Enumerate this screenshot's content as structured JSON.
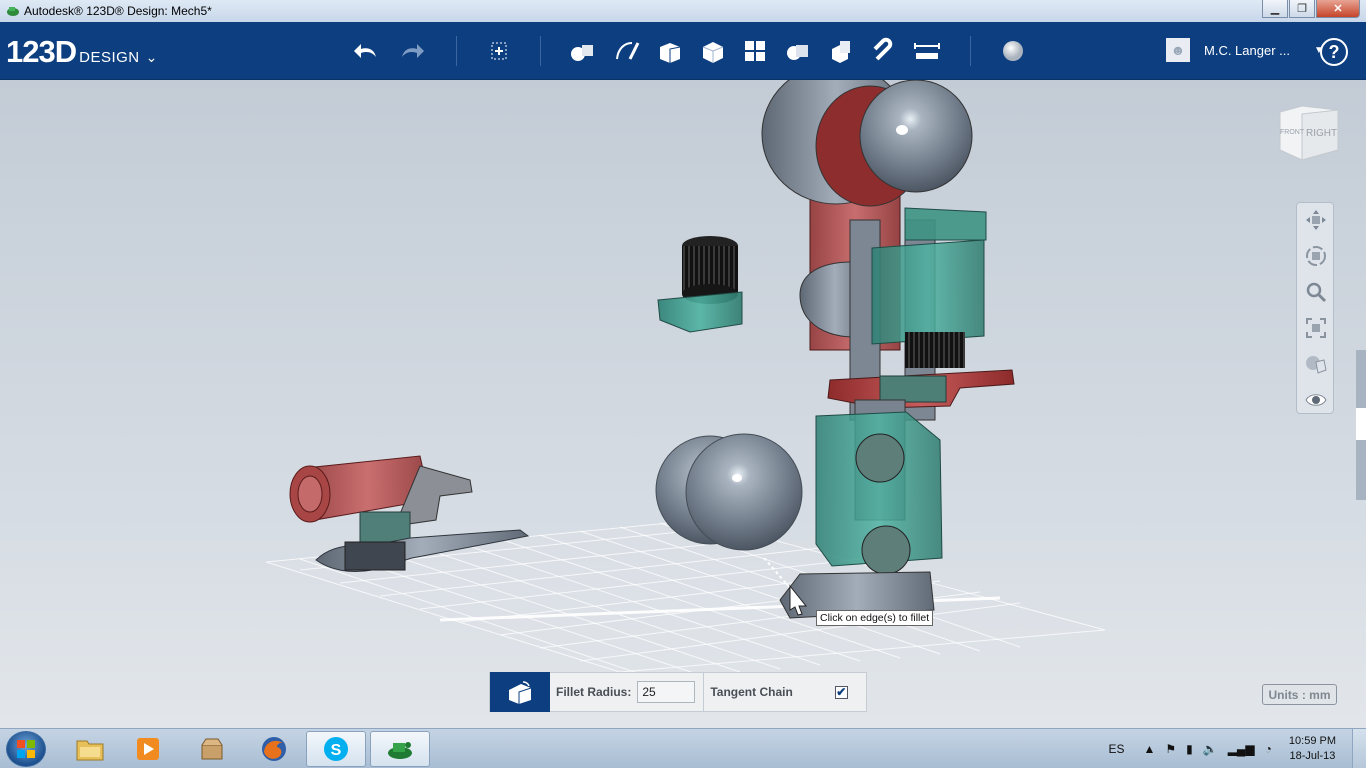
{
  "window": {
    "title": "Autodesk® 123D® Design: Mech5*",
    "minimize": "▁",
    "maximize": "❐",
    "close": "✕"
  },
  "toolbar": {
    "logo_number": "123D",
    "logo_word": "DESIGN",
    "logo_chevron": "⌄",
    "tools": [
      "undo-icon",
      "redo-icon",
      "transform-icon",
      "primitives-icon",
      "sketch-icon",
      "construct-icon",
      "modify-icon",
      "pattern-icon",
      "grouping-icon",
      "combine-icon",
      "snap-icon",
      "measure-icon",
      "material-icon"
    ],
    "user_name": "M.C. Langer ...",
    "user_caret": "▼",
    "help": "?"
  },
  "viewcube": {
    "left_face": "FRONT",
    "right_face": "RIGHT"
  },
  "tooltip": "Click on edge(s) to fillet",
  "fillet": {
    "radius_label": "Fillet Radius:",
    "radius_value": "25",
    "tangent_label": "Tangent Chain",
    "tangent_checked": true,
    "check_mark": "✔"
  },
  "units": "Units : mm",
  "taskbar": {
    "language": "ES",
    "time": "10:59 PM",
    "date": "18-Jul-13",
    "apps": [
      "explorer-icon",
      "media-player-icon",
      "archive-icon",
      "firefox-icon",
      "skype-icon",
      "123d-design-icon"
    ]
  },
  "colors": {
    "toolbar": "#0d3f80",
    "teal_part": "#3e9f8f",
    "red_part": "#b23a3a",
    "grey_part": "#8c96a3"
  }
}
